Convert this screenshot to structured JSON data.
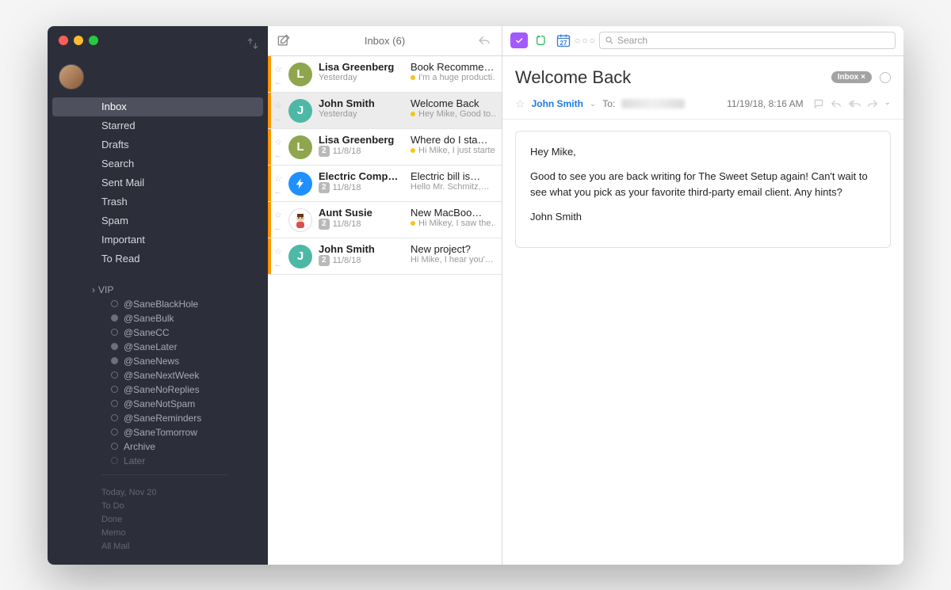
{
  "sidebar": {
    "main_items": [
      {
        "label": "Inbox",
        "selected": true
      },
      {
        "label": "Starred",
        "selected": false
      },
      {
        "label": "Drafts",
        "selected": false
      },
      {
        "label": "Search",
        "selected": false
      },
      {
        "label": "Sent Mail",
        "selected": false
      },
      {
        "label": "Trash",
        "selected": false
      },
      {
        "label": "Spam",
        "selected": false
      },
      {
        "label": "Important",
        "selected": false
      },
      {
        "label": "To Read",
        "selected": false
      }
    ],
    "vip": {
      "header": "VIP",
      "items": [
        {
          "label": "@SaneBlackHole"
        },
        {
          "label": "@SaneBulk"
        },
        {
          "label": "@SaneCC"
        },
        {
          "label": "@SaneLater"
        },
        {
          "label": "@SaneNews"
        },
        {
          "label": "@SaneNextWeek"
        },
        {
          "label": "@SaneNoReplies"
        },
        {
          "label": "@SaneNotSpam"
        },
        {
          "label": "@SaneReminders"
        },
        {
          "label": "@SaneTomorrow"
        },
        {
          "label": "Archive"
        },
        {
          "label": "Later"
        }
      ]
    },
    "bottom": {
      "today": "Today, Nov 20",
      "todo": "To Do",
      "done": "Done",
      "memo": "Memo",
      "allmail": "All Mail"
    }
  },
  "list": {
    "title": "Inbox (6)",
    "rows": [
      {
        "initial": "L",
        "avatar_class": "av-L",
        "from": "Lisa Greenberg",
        "date": "Yesterday",
        "count": 0,
        "subject": "Book Recomme…",
        "preview": "I'm a huge producti…",
        "unread": true,
        "flag": true
      },
      {
        "initial": "J",
        "avatar_class": "av-J",
        "from": "John Smith",
        "date": "Yesterday",
        "count": 0,
        "subject": "Welcome Back",
        "preview": "Hey Mike, Good to…",
        "unread": true,
        "flag": true,
        "selected": true
      },
      {
        "initial": "L",
        "avatar_class": "av-L",
        "from": "Lisa Greenberg",
        "date": "11/8/18",
        "count": 2,
        "subject": "Where do I sta…",
        "preview": "Hi Mike, I just starte…",
        "unread": true,
        "flag": true
      },
      {
        "initial": "",
        "avatar_class": "av-bolt",
        "from": "Electric Comp…",
        "date": "11/8/18",
        "count": 2,
        "subject": "Electric bill is…",
        "preview": "Hello Mr. Schmitz,…",
        "unread": true,
        "flag": false
      },
      {
        "initial": "",
        "avatar_class": "av-face",
        "from": "Aunt Susie",
        "date": "11/8/18",
        "count": 2,
        "subject": "New MacBoo…",
        "preview": "Hi Mikey, I saw the…",
        "unread": true,
        "flag": true
      },
      {
        "initial": "J",
        "avatar_class": "av-J",
        "from": "John Smith",
        "date": "11/8/18",
        "count": 2,
        "subject": "New project?",
        "preview": "Hi Mike, I hear you'…",
        "unread": true,
        "flag": false
      }
    ]
  },
  "toolbar": {
    "search_placeholder": "Search",
    "calendar_day": "27"
  },
  "reader": {
    "title": "Welcome Back",
    "tag": "Inbox ×",
    "from": "John Smith",
    "to_label": "To:",
    "timestamp": "11/19/18, 8:16 AM",
    "body_greeting": "Hey Mike,",
    "body_main": "Good to see you are back writing for The Sweet Setup again! Can't wait to see what you pick as your favorite third-party email client. Any hints?",
    "body_sig": "John Smith"
  }
}
